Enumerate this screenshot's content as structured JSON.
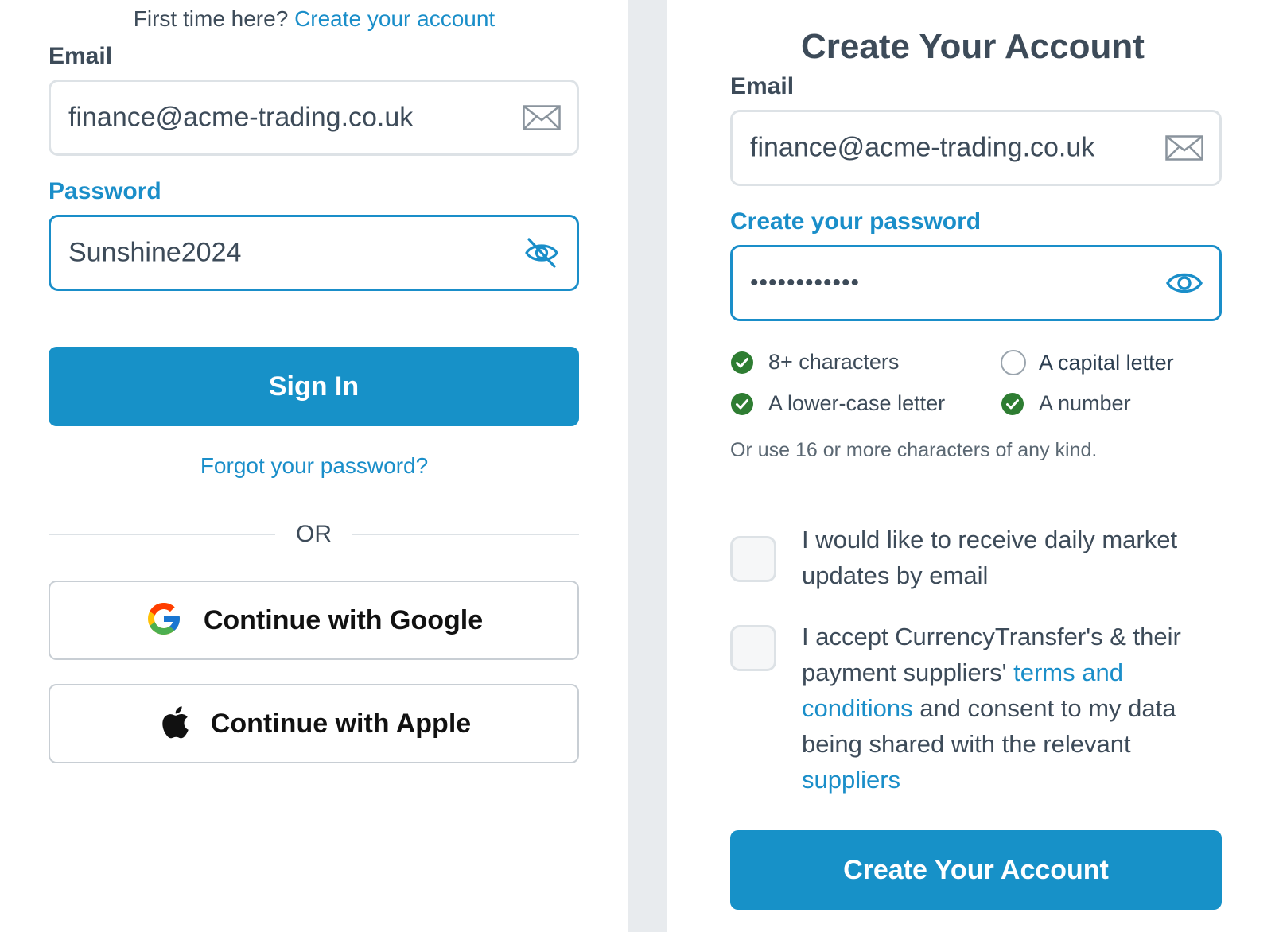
{
  "signin": {
    "first_time_text": "First time here?",
    "create_account_link": "Create your account",
    "email_label": "Email",
    "email_value": "finance@acme-trading.co.uk",
    "email_icon": "envelope-icon",
    "password_label": "Password",
    "password_value": "Sunshine2024",
    "password_icon": "eye-slash-icon",
    "sign_in_button": "Sign In",
    "forgot_link": "Forgot your password?",
    "or_text": "OR",
    "google_button": "Continue with Google",
    "google_icon": "google-icon",
    "apple_button": "Continue with Apple",
    "apple_icon": "apple-icon"
  },
  "signup": {
    "heading": "Create Your Account",
    "email_label": "Email",
    "email_value": "finance@acme-trading.co.uk",
    "email_icon": "envelope-icon",
    "password_label": "Create your password",
    "password_masked": "••••••••••••",
    "password_icon": "eye-icon",
    "requirements": [
      {
        "label": "8+ characters",
        "met": true
      },
      {
        "label": "A capital letter",
        "met": false
      },
      {
        "label": "A lower-case letter",
        "met": true
      },
      {
        "label": "A number",
        "met": true
      }
    ],
    "alt_hint": "Or use 16 or more characters of any kind.",
    "marketing_consent": {
      "line1": "I would like to receive daily market",
      "line2": "updates by email",
      "checked": false
    },
    "terms_consent": {
      "part1": "I accept CurrencyTransfer's & their payment suppliers'",
      "terms_link": "terms and conditions",
      "part2": "and consent to my data being shared with the relevant",
      "suppliers_link": "suppliers",
      "checked": false
    },
    "submit_button": "Create Your Account"
  },
  "colors": {
    "accent": "#1791c8",
    "link": "#1a8ec9",
    "success": "#2e7d32",
    "text": "#3d4b59",
    "border": "#dde2e6",
    "divider": "#e8ebee"
  }
}
